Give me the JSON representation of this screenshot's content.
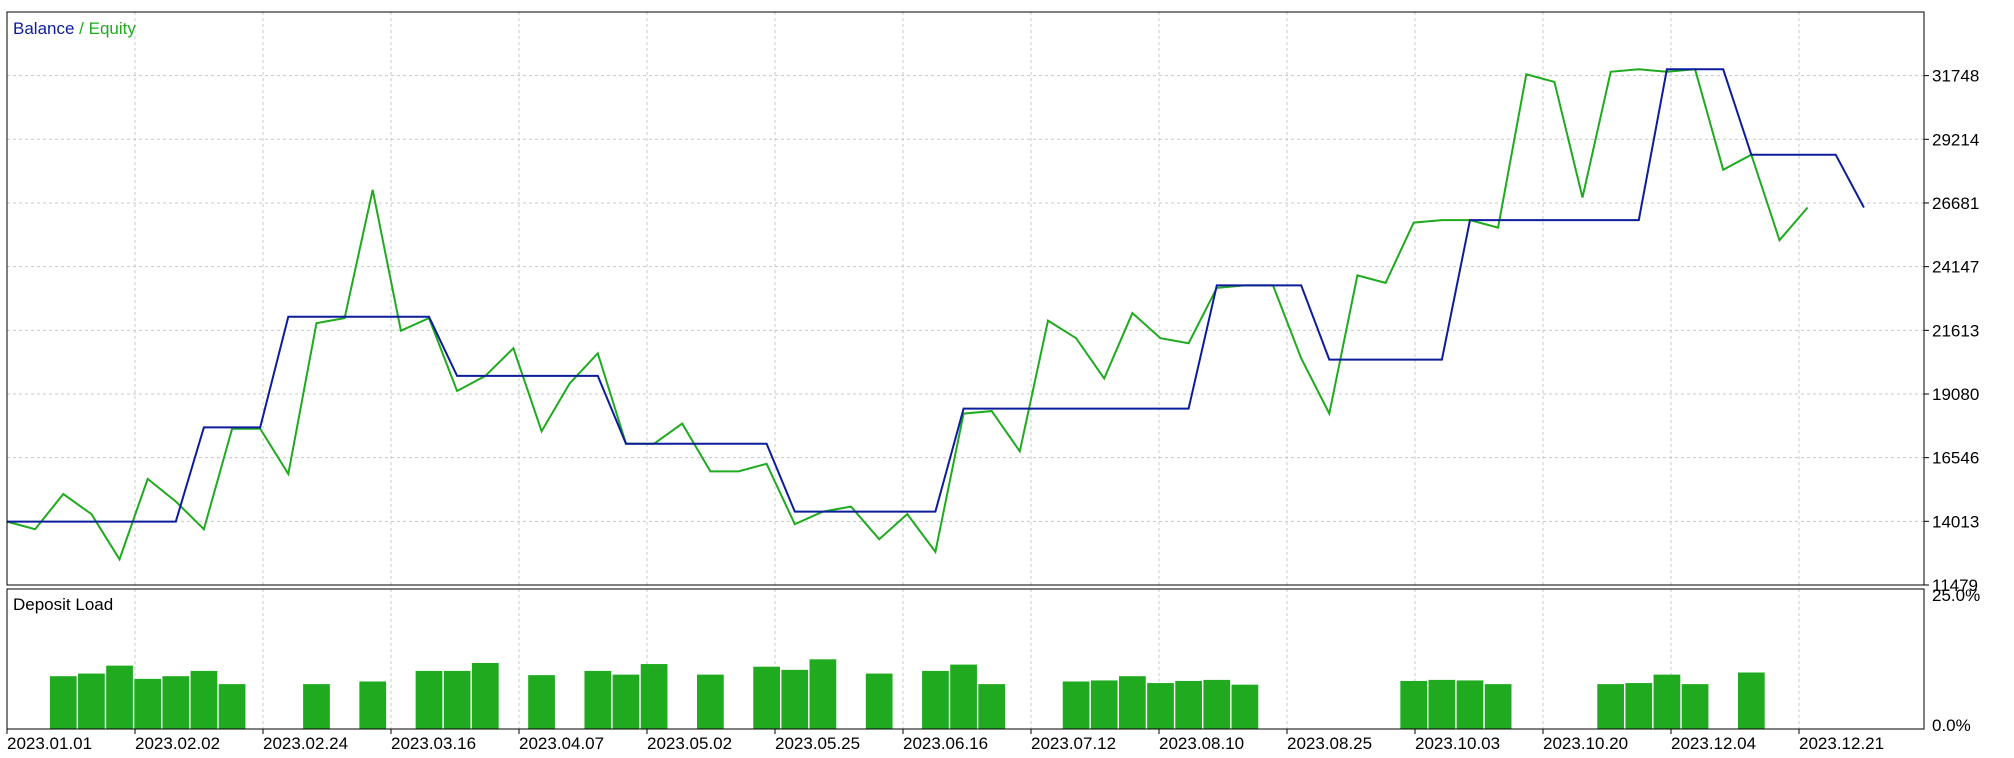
{
  "legend": {
    "balance": "Balance",
    "separator": " / ",
    "equity": "Equity"
  },
  "colors": {
    "balance": "#0b1d9a",
    "equity": "#1faa1f",
    "bar": "#1faa1f",
    "grid": "#c8c8c8",
    "frame": "#000000",
    "text": "#000000"
  },
  "chart_data": [
    {
      "type": "line",
      "title": "",
      "y_ticks": [
        11479,
        14013,
        16546,
        19080,
        21613,
        24147,
        26681,
        29214,
        31748
      ],
      "ylim": [
        11479,
        34280
      ],
      "x_range": [
        0,
        67
      ],
      "grid": true,
      "legend_position": "top-left",
      "series": [
        {
          "name": "Balance",
          "values": [
            [
              0,
              14000
            ],
            [
              6,
              14000
            ],
            [
              7,
              17750
            ],
            [
              9,
              17750
            ],
            [
              10,
              22150
            ],
            [
              15,
              22150
            ],
            [
              16,
              19800
            ],
            [
              21,
              19800
            ],
            [
              22,
              17100
            ],
            [
              27,
              17100
            ],
            [
              28,
              14400
            ],
            [
              33,
              14400
            ],
            [
              34,
              18500
            ],
            [
              42,
              18500
            ],
            [
              43,
              23400
            ],
            [
              46,
              23400
            ],
            [
              47,
              20450
            ],
            [
              51,
              20450
            ],
            [
              52,
              26000
            ],
            [
              58,
              26000
            ],
            [
              59,
              32000
            ],
            [
              61,
              32000
            ],
            [
              62,
              28600
            ],
            [
              65,
              28600
            ],
            [
              66,
              26500
            ]
          ]
        },
        {
          "name": "Equity",
          "values": [
            [
              0,
              14000
            ],
            [
              1,
              13700
            ],
            [
              2,
              15100
            ],
            [
              3,
              14300
            ],
            [
              4,
              12500
            ],
            [
              5,
              15700
            ],
            [
              6,
              14800
            ],
            [
              7,
              13700
            ],
            [
              8,
              17700
            ],
            [
              9,
              17700
            ],
            [
              10,
              15900
            ],
            [
              11,
              21900
            ],
            [
              12,
              22100
            ],
            [
              13,
              27200
            ],
            [
              14,
              21600
            ],
            [
              15,
              22100
            ],
            [
              16,
              19200
            ],
            [
              17,
              19800
            ],
            [
              18,
              20900
            ],
            [
              19,
              17600
            ],
            [
              20,
              19500
            ],
            [
              21,
              20700
            ],
            [
              22,
              17100
            ],
            [
              23,
              17100
            ],
            [
              24,
              17900
            ],
            [
              25,
              16000
            ],
            [
              26,
              16000
            ],
            [
              27,
              16300
            ],
            [
              28,
              13900
            ],
            [
              29,
              14400
            ],
            [
              30,
              14600
            ],
            [
              31,
              13300
            ],
            [
              32,
              14300
            ],
            [
              33,
              12800
            ],
            [
              34,
              18300
            ],
            [
              35,
              18400
            ],
            [
              36,
              16800
            ],
            [
              37,
              22000
            ],
            [
              38,
              21300
            ],
            [
              39,
              19700
            ],
            [
              40,
              22300
            ],
            [
              41,
              21300
            ],
            [
              42,
              21100
            ],
            [
              43,
              23300
            ],
            [
              44,
              23400
            ],
            [
              45,
              23400
            ],
            [
              46,
              20500
            ],
            [
              47,
              18300
            ],
            [
              48,
              23800
            ],
            [
              49,
              23500
            ],
            [
              50,
              25900
            ],
            [
              51,
              26000
            ],
            [
              52,
              26000
            ],
            [
              53,
              25700
            ],
            [
              54,
              31800
            ],
            [
              55,
              31500
            ],
            [
              56,
              26900
            ],
            [
              57,
              31900
            ],
            [
              58,
              32000
            ],
            [
              59,
              31900
            ],
            [
              60,
              32000
            ],
            [
              61,
              28000
            ],
            [
              62,
              28600
            ],
            [
              63,
              25200
            ],
            [
              64,
              26500
            ]
          ]
        }
      ]
    },
    {
      "type": "bar",
      "title": "Deposit Load",
      "y_ticks": [
        "25.0%",
        "0.0%"
      ],
      "ylim": [
        0,
        25
      ],
      "x_range": [
        0,
        67
      ],
      "bars": [
        {
          "x": 2,
          "v": 10
        },
        {
          "x": 3,
          "v": 10.5
        },
        {
          "x": 4,
          "v": 12
        },
        {
          "x": 5,
          "v": 9.5
        },
        {
          "x": 6,
          "v": 10
        },
        {
          "x": 7,
          "v": 11
        },
        {
          "x": 8,
          "v": 8.5
        },
        {
          "x": 11,
          "v": 8.5
        },
        {
          "x": 13,
          "v": 9
        },
        {
          "x": 15,
          "v": 11
        },
        {
          "x": 16,
          "v": 11
        },
        {
          "x": 17,
          "v": 12.5
        },
        {
          "x": 19,
          "v": 10.2
        },
        {
          "x": 21,
          "v": 11
        },
        {
          "x": 22,
          "v": 10.3
        },
        {
          "x": 23,
          "v": 12.3
        },
        {
          "x": 25,
          "v": 10.3
        },
        {
          "x": 27,
          "v": 11.8
        },
        {
          "x": 28,
          "v": 11.2
        },
        {
          "x": 29,
          "v": 13.2
        },
        {
          "x": 31,
          "v": 10.5
        },
        {
          "x": 33,
          "v": 11
        },
        {
          "x": 34,
          "v": 12.2
        },
        {
          "x": 35,
          "v": 8.5
        },
        {
          "x": 38,
          "v": 9
        },
        {
          "x": 39,
          "v": 9.2
        },
        {
          "x": 40,
          "v": 10
        },
        {
          "x": 41,
          "v": 8.7
        },
        {
          "x": 42,
          "v": 9.1
        },
        {
          "x": 43,
          "v": 9.3
        },
        {
          "x": 44,
          "v": 8.4
        },
        {
          "x": 50,
          "v": 9.1
        },
        {
          "x": 51,
          "v": 9.3
        },
        {
          "x": 52,
          "v": 9.2
        },
        {
          "x": 53,
          "v": 8.5
        },
        {
          "x": 57,
          "v": 8.5
        },
        {
          "x": 58,
          "v": 8.7
        },
        {
          "x": 59,
          "v": 10.3
        },
        {
          "x": 60,
          "v": 8.5
        },
        {
          "x": 62,
          "v": 10.7
        }
      ]
    }
  ],
  "x_axis": {
    "labels": [
      "2023.01.01",
      "2023.02.02",
      "2023.02.24",
      "2023.03.16",
      "2023.04.07",
      "2023.05.02",
      "2023.05.25",
      "2023.06.16",
      "2023.07.12",
      "2023.08.10",
      "2023.08.25",
      "2023.10.03",
      "2023.10.20",
      "2023.12.04",
      "2023.12.21"
    ]
  }
}
